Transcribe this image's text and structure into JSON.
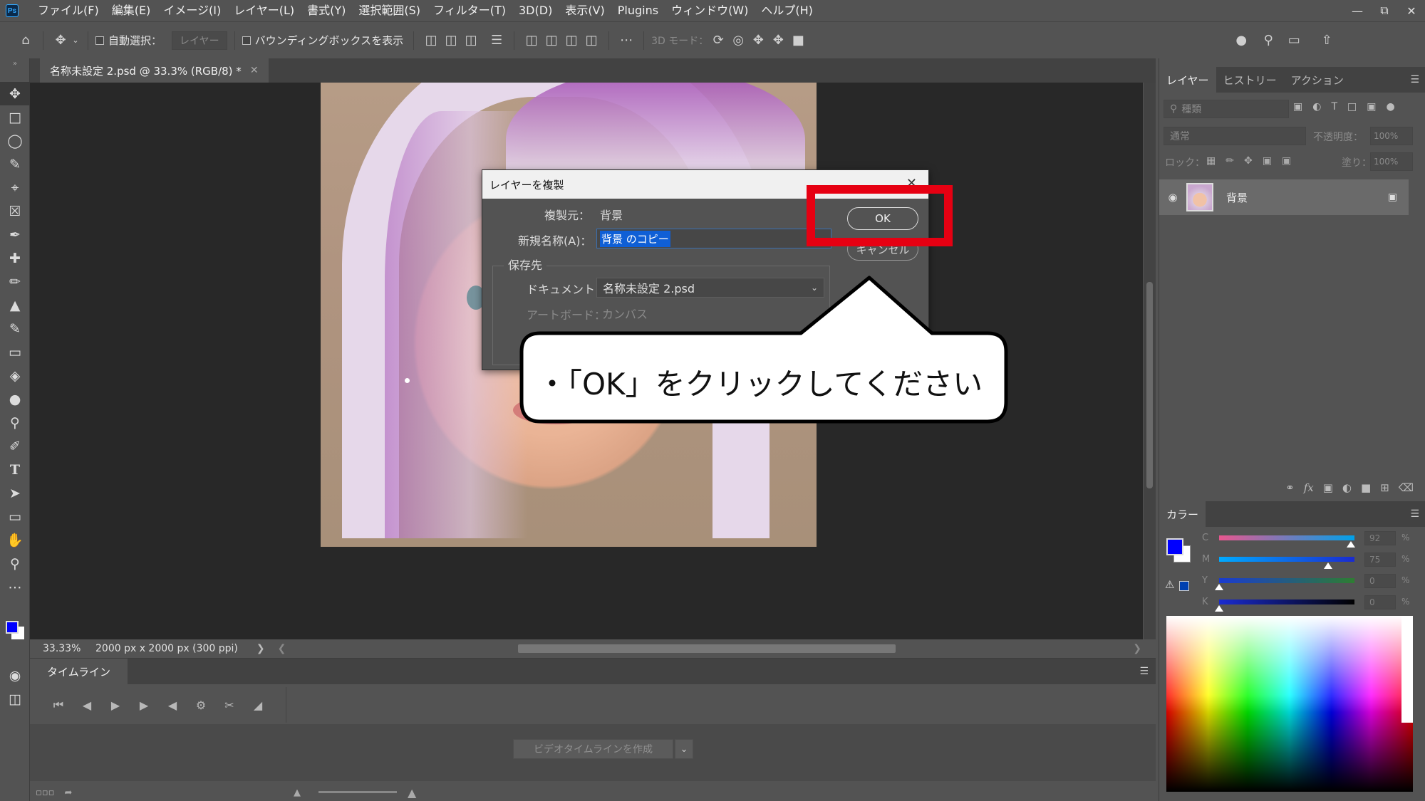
{
  "app": {
    "logo": "Ps",
    "menu": [
      "ファイル(F)",
      "編集(E)",
      "イメージ(I)",
      "レイヤー(L)",
      "書式(Y)",
      "選択範囲(S)",
      "フィルター(T)",
      "3D(D)",
      "表示(V)",
      "Plugins",
      "ウィンドウ(W)",
      "ヘルプ(H)"
    ]
  },
  "options_bar": {
    "auto_select_label": "自動選択：",
    "auto_select_target": "レイヤー",
    "bounding_box_label": "バウンディングボックスを表示",
    "mode_3d_label": "3D モード："
  },
  "document": {
    "tab_title": "名称未設定 2.psd @ 33.3% (RGB/8) *",
    "zoom": "33.33%",
    "doc_info": "2000 px x 2000 px (300 ppi)"
  },
  "timeline": {
    "tab_label": "タイムライン",
    "create_button": "ビデオタイムラインを作成"
  },
  "layers_panel": {
    "tabs": [
      "レイヤー",
      "ヒストリー",
      "アクション"
    ],
    "kind_placeholder": "種類",
    "blend_mode": "通常",
    "opacity_label": "不透明度：",
    "opacity_value": "100%",
    "lock_label": "ロック：",
    "fill_label": "塗り：",
    "fill_value": "100%",
    "layers": [
      {
        "name": "背景"
      }
    ]
  },
  "color_panel": {
    "tab_label": "カラー",
    "foreground_color": "#0000ff",
    "channels": [
      {
        "label": "C",
        "value": "92",
        "unit": "%"
      },
      {
        "label": "M",
        "value": "75",
        "unit": "%"
      },
      {
        "label": "Y",
        "value": "0",
        "unit": "%"
      },
      {
        "label": "K",
        "value": "0",
        "unit": "%"
      }
    ]
  },
  "dialog": {
    "title": "レイヤーを複製",
    "source_label": "複製元：",
    "source_value": "背景",
    "new_name_label": "新規名称(A)：",
    "new_name_value": "背景 のコピー",
    "destination_label": "保存先",
    "document_label": "ドキュメント：",
    "document_value": "名称未設定 2.psd",
    "artboard_label": "アートボード：",
    "artboard_value": "カンバス",
    "ok_label": "OK",
    "cancel_label": "キャンセル"
  },
  "annotation": {
    "highlight_color": "#e60012",
    "callout_text": "・「OK」をクリックしてください"
  }
}
